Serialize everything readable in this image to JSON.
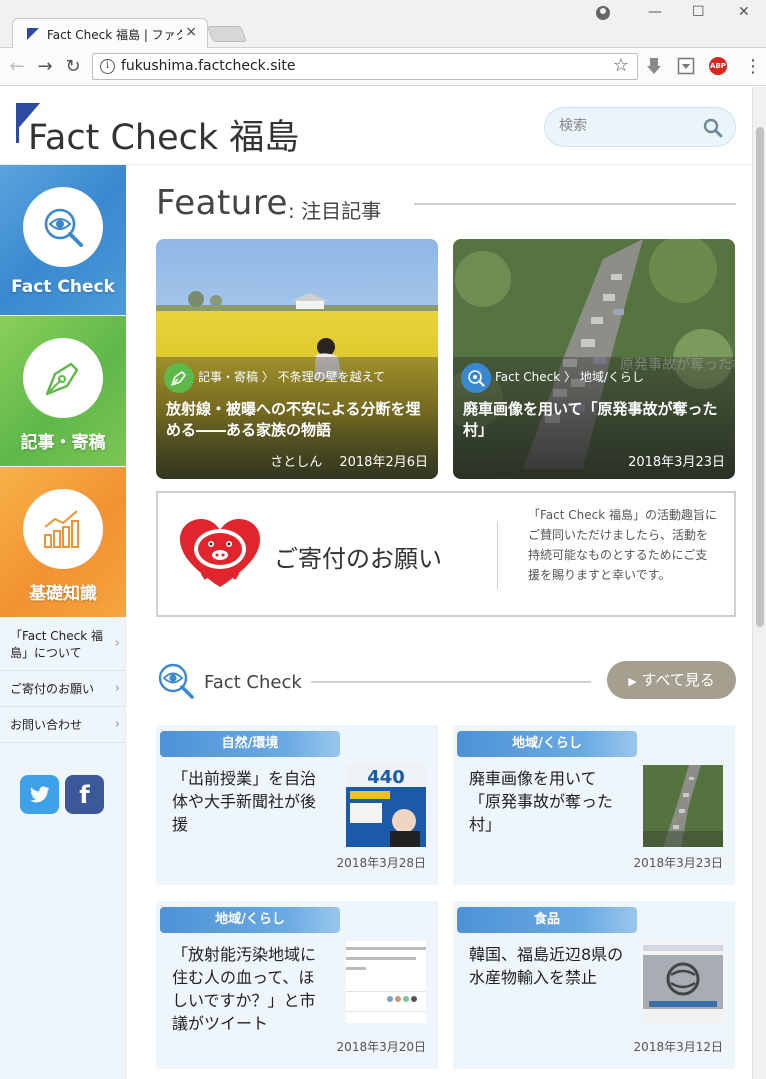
{
  "browser": {
    "tab_title": "Fact Check 福島 | ファクトチ",
    "tab_close": "×",
    "url": "fukushima.factcheck.site",
    "info_glyph": "i",
    "ext_abp": "ABP",
    "window_controls": [
      "—",
      "☐",
      "✕"
    ],
    "nav": [
      "←",
      "→",
      "↻"
    ]
  },
  "header": {
    "logo_text": "Fact Check 福島",
    "search_placeholder": "検索"
  },
  "sidebar": {
    "categories": [
      {
        "label": "Fact Check",
        "icon": "magnifier-eye-icon",
        "color": "#3a88cf"
      },
      {
        "label": "記事・寄稿",
        "icon": "pen-nib-icon",
        "color": "#5fb84a"
      },
      {
        "label": "基礎知識",
        "icon": "chart-icon",
        "color": "#f29232"
      }
    ],
    "links": [
      {
        "label": "「Fact Check 福島」について"
      },
      {
        "label": "ご寄付のお願い"
      },
      {
        "label": "お問い合わせ"
      }
    ],
    "chevron": "›",
    "social": {
      "twitter": "twitter-icon",
      "facebook": "f"
    }
  },
  "feature": {
    "title": "Feature",
    "subtitle": ": 注目記事",
    "cards": [
      {
        "category": "記事・寄稿",
        "crumb": "記事・寄稿 〉 不条理の壁を越えて",
        "title": "放射線・被曝への不安による分断を埋める――ある家族の物語",
        "author": "さとしん",
        "date": "2018年2月6日",
        "badge_color": "#5fb84a"
      },
      {
        "category": "Fact Check",
        "crumb": "Fact Check 〉 地域/くらし",
        "title": "廃車画像を用いて「原発事故が奪った村」",
        "date": "2018年3月23日",
        "badge_color": "#3a88cf"
      }
    ]
  },
  "donate": {
    "title": "ご寄付のお願い",
    "text": "「Fact Check 福島」の活動趣旨にご賛同いただけましたら、活動を持続可能なものとするためにご支援を賜りますと幸いです。"
  },
  "factcheck": {
    "title": "Fact Check",
    "see_all": "すべて見る",
    "cards": [
      {
        "tag": "自然/環境",
        "title": "「出前授業」を自治体や大手新聞社が後援",
        "date": "2018年3月28日"
      },
      {
        "tag": "地域/くらし",
        "title": "廃車画像を用いて「原発事故が奪った村」",
        "date": "2018年3月23日"
      },
      {
        "tag": "地域/くらし",
        "title": "「放射能汚染地域に住む人の血って、ほしいですか？」と市議がツイート",
        "date": "2018年3月20日"
      },
      {
        "tag": "食品",
        "title": "韓国、福島近辺8県の水産物輸入を禁止",
        "date": "2018年3月12日"
      }
    ]
  }
}
